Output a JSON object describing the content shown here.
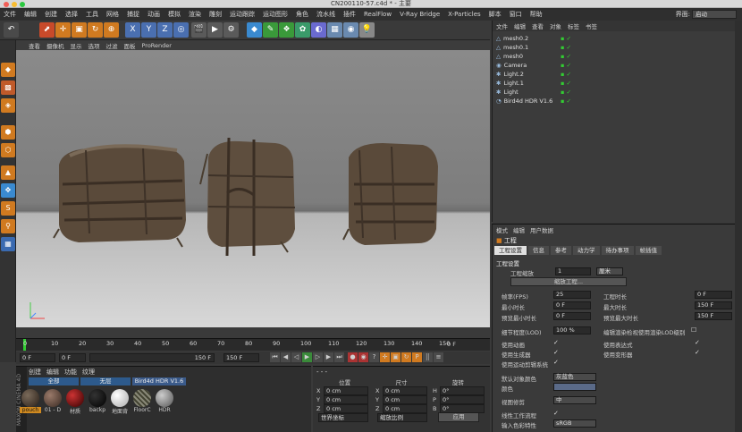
{
  "window": {
    "title": "CN200110-57.c4d * - 主要"
  },
  "menubar": [
    "文件",
    "编辑",
    "创建",
    "选择",
    "工具",
    "网格",
    "捕捉",
    "动画",
    "模拟",
    "渲染",
    "雕刻",
    "运动跟踪",
    "运动图形",
    "角色",
    "流水线",
    "插件",
    "RealFlow",
    "V-Ray Bridge",
    "X-Particles",
    "脚本",
    "窗口",
    "帮助"
  ],
  "layout": {
    "label": "界面:",
    "value": "启动"
  },
  "toolbar_axes": [
    "X",
    "Y",
    "Z"
  ],
  "viewport_menu": [
    "查看",
    "摄像机",
    "显示",
    "选项",
    "过滤",
    "面板",
    "ProRender"
  ],
  "timeline": {
    "ticks": [
      "0",
      "10",
      "20",
      "30",
      "40",
      "50",
      "60",
      "70",
      "80",
      "90",
      "100",
      "110",
      "120",
      "130",
      "140",
      "150"
    ],
    "end": "0 F"
  },
  "transport": {
    "start": "0 F",
    "current": "0 F",
    "end": "150 F",
    "end2": "150 F"
  },
  "materials": {
    "menu": [
      "创建",
      "编辑",
      "功能",
      "纹理"
    ],
    "filters": [
      "全部",
      "无层",
      "Bird4d HDR V1.6"
    ],
    "items": [
      "pouch",
      "01 - D",
      "材质",
      "backp",
      "地面背",
      "FloorC",
      "HDR"
    ],
    "side_logo": "MAXON CINEMA 4D"
  },
  "coords": {
    "headers": [
      "位置",
      "尺寸",
      "旋转"
    ],
    "rows": [
      {
        "a": "X",
        "v1": "0 cm",
        "b": "X",
        "v2": "0 cm",
        "c": "H",
        "v3": "0°"
      },
      {
        "a": "Y",
        "v1": "0 cm",
        "b": "Y",
        "v2": "0 cm",
        "c": "P",
        "v3": "0°"
      },
      {
        "a": "Z",
        "v1": "0 cm",
        "b": "Z",
        "v2": "0 cm",
        "c": "B",
        "v3": "0°"
      }
    ],
    "mode1": "世界坐标",
    "mode2": "缩放比例",
    "apply": "应用"
  },
  "objects": {
    "menu": [
      "文件",
      "编辑",
      "查看",
      "对象",
      "标签",
      "书签"
    ],
    "items": [
      "mesh0.2",
      "mesh0.1",
      "mesh0",
      "Camera",
      "Light.2",
      "Light.1",
      "Light",
      "Bird4d HDR V1.6"
    ]
  },
  "attributes": {
    "menu": [
      "模式",
      "编辑",
      "用户数据"
    ],
    "section": "工程",
    "tabs": [
      "工程设置",
      "信息",
      "参考",
      "动力学",
      "待办事项",
      "帧插值"
    ],
    "group": "工程设置",
    "scale_label": "工程缩放",
    "scale_value": "1",
    "scale_unit": "厘米",
    "scale_button": "缩放工程...",
    "fps_label": "帧率(FPS)",
    "fps_value": "25",
    "project_time_label": "工程时长",
    "project_time_value": "0 F",
    "min_time_label": "最小时长",
    "min_time_value": "0 F",
    "max_time_label": "最大时长",
    "max_time_value": "150 F",
    "preview_min_label": "预览最小时长",
    "preview_min_value": "0 F",
    "preview_max_label": "预览最大时长",
    "preview_max_value": "150 F",
    "lod_label": "细节程度(LOD)",
    "lod_value": "100 %",
    "lod_render_label": "编辑渲染检视使用渲染LOD级别",
    "use_anim": "使用动画",
    "use_expr": "使用表达式",
    "use_gen": "使用生成器",
    "use_deform": "使用变形器",
    "use_motion": "使用运动剪辑系统",
    "default_color_label": "默认对象颜色",
    "default_color_value": "灰蓝色",
    "color_label": "颜色",
    "view_correct_label": "视图修剪",
    "view_correct_value": "中",
    "linear_label": "线性工作流程",
    "input_color_label": "输入色彩特性",
    "input_color_value": "sRGB"
  }
}
